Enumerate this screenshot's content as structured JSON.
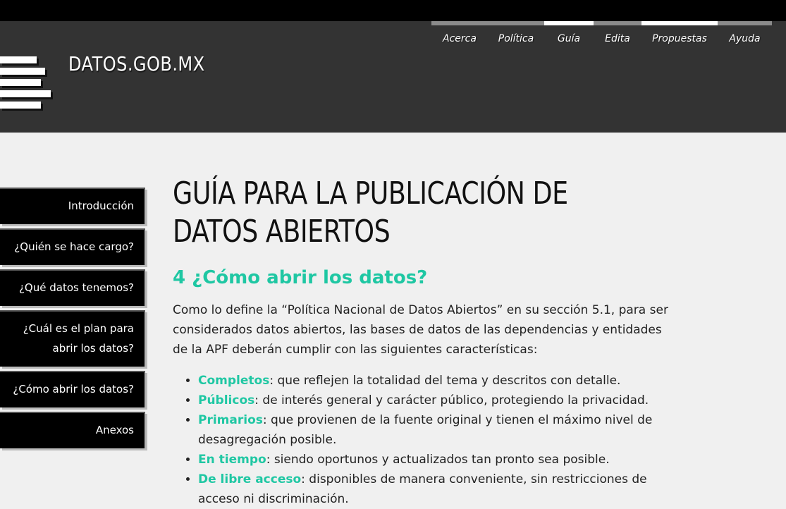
{
  "site": {
    "title": "DATOS.GOB.MX"
  },
  "nav": [
    {
      "label": "Acerca"
    },
    {
      "label": "Política"
    },
    {
      "label": "Guía"
    },
    {
      "label": "Edita"
    },
    {
      "label": "Propuestas"
    },
    {
      "label": "Ayuda"
    }
  ],
  "sidebar": {
    "items": [
      {
        "label": "Introducción"
      },
      {
        "label": "¿Quién se hace cargo?"
      },
      {
        "label": "¿Qué datos tenemos?"
      },
      {
        "label": "¿Cuál es el plan para abrir los datos?"
      },
      {
        "label": "¿Cómo abrir los datos?"
      },
      {
        "label": "Anexos"
      }
    ]
  },
  "main": {
    "title": "GUÍA PARA LA PUBLICACIÓN DE DATOS ABIERTOS",
    "section_heading": "4 ¿Cómo abrir los datos?",
    "intro": "Como lo define la “Política Nacional de Datos Abiertos” en su sección 5.1, para ser considerados datos abiertos, las bases de datos de las dependencias y entidades de la APF deberán cumplir con las siguientes características:",
    "features": [
      {
        "term": "Completos",
        "desc": ": que reflejen la totalidad del tema y descritos con detalle."
      },
      {
        "term": "Públicos",
        "desc": ": de interés general y carácter público, protegiendo la privacidad."
      },
      {
        "term": "Primarios",
        "desc": ": que provienen de la fuente original y tienen el máximo nivel de desagregación posible."
      },
      {
        "term": "En tiempo",
        "desc": ": siendo oportunos y actualizados tan pronto sea posible."
      },
      {
        "term": "De libre acceso",
        "desc": ": disponibles de manera conveniente, sin restricciones de acceso ni discriminación."
      }
    ]
  },
  "colors": {
    "accent": "#1fc7a3",
    "header_bg": "#333333",
    "page_bg": "#f0f0f0",
    "sidebar_bg": "#000000"
  },
  "icons": {
    "logo": "stacked-bars-logo-icon"
  }
}
